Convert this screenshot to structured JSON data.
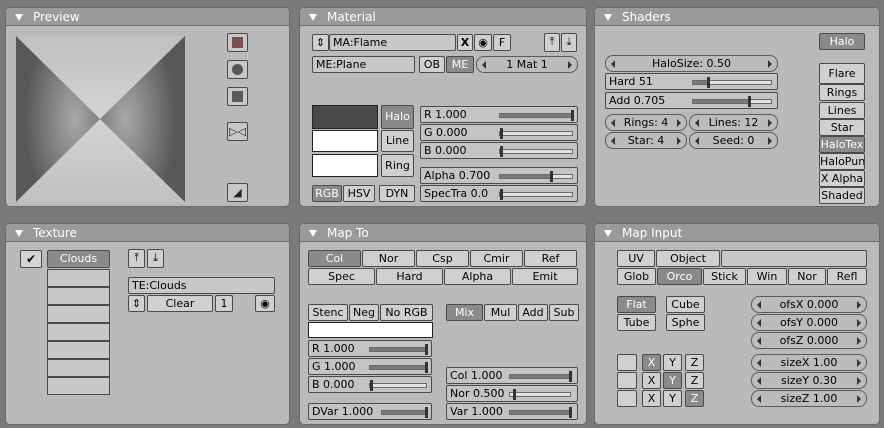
{
  "preview": {
    "title": "Preview"
  },
  "material": {
    "title": "Material",
    "ma_name": "MA:Flame",
    "x_label": "X",
    "f_label": "F",
    "me_name": "ME:Plane",
    "ob_label": "OB",
    "me_label": "ME",
    "mat_count": "1 Mat 1",
    "halo_label": "Halo",
    "line_label": "Line",
    "ring_label": "Ring",
    "r": "R 1.000",
    "g": "G 0.000",
    "b": "B 0.000",
    "rgb": "RGB",
    "hsv": "HSV",
    "dyn": "DYN",
    "alpha": "Alpha 0.700",
    "spectra": "SpecTra 0.0",
    "swatch_colors": [
      "#4a4a4a",
      "#ffffff",
      "#ffffff"
    ],
    "levels": {
      "r": 1.0,
      "g": 0.0,
      "b": 0.0,
      "alpha": 0.7,
      "spectra": 0.0
    }
  },
  "shaders": {
    "title": "Shaders",
    "halo_badge": "Halo",
    "halosize": "HaloSize: 0.50",
    "hard": "Hard 51",
    "add": "Add  0.705",
    "rings": "Rings: 4",
    "lines": "Lines: 12",
    "star": "Star: 4",
    "seed": "Seed: 0",
    "toggles": [
      "Flare",
      "Rings",
      "Lines",
      "Star",
      "HaloTex",
      "HaloPun",
      "X Alpha",
      "Shaded"
    ],
    "active_toggles": [
      "HaloTex"
    ],
    "levels": {
      "hard": 0.2,
      "add": 0.705
    }
  },
  "texture": {
    "title": "Texture",
    "slot_name": "Clouds",
    "te_name": "TE:Clouds",
    "clear_label": "Clear",
    "users": "1"
  },
  "mapto": {
    "title": "Map To",
    "row1": [
      "Col",
      "Nor",
      "Csp",
      "Cmir",
      "Ref"
    ],
    "row2": [
      "Spec",
      "Hard",
      "Alpha",
      "Emit"
    ],
    "stenc": "Stenc",
    "neg": "Neg",
    "norgb": "No RGB",
    "blend": [
      "Mix",
      "Mul",
      "Add",
      "Sub"
    ],
    "r": "R 1.000",
    "g": "G 1.000",
    "b": "B 0.000",
    "dvar": "DVar 1.000",
    "col": "Col 1.000",
    "nor": "Nor 0.500",
    "var": "Var 1.000",
    "levels": {
      "r": 1.0,
      "g": 1.0,
      "b": 0.0,
      "dvar": 1.0,
      "col": 1.0,
      "nor": 0.05,
      "var": 1.0
    }
  },
  "mapinput": {
    "title": "Map Input",
    "uv": "UV",
    "object": "Object",
    "coords": [
      "Glob",
      "Orco",
      "Stick",
      "Win",
      "Nor",
      "Refl"
    ],
    "active_coord": "Orco",
    "proj": [
      "Flat",
      "Cube",
      "Tube",
      "Sphe"
    ],
    "active_proj": "Flat",
    "ofsx": "ofsX 0.000",
    "ofsy": "ofsY 0.000",
    "ofsz": "ofsZ 0.000",
    "sizex": "sizeX 1.00",
    "sizey": "sizeY 0.30",
    "sizez": "sizeZ 1.00",
    "xyz": [
      "X",
      "Y",
      "Z"
    ]
  }
}
